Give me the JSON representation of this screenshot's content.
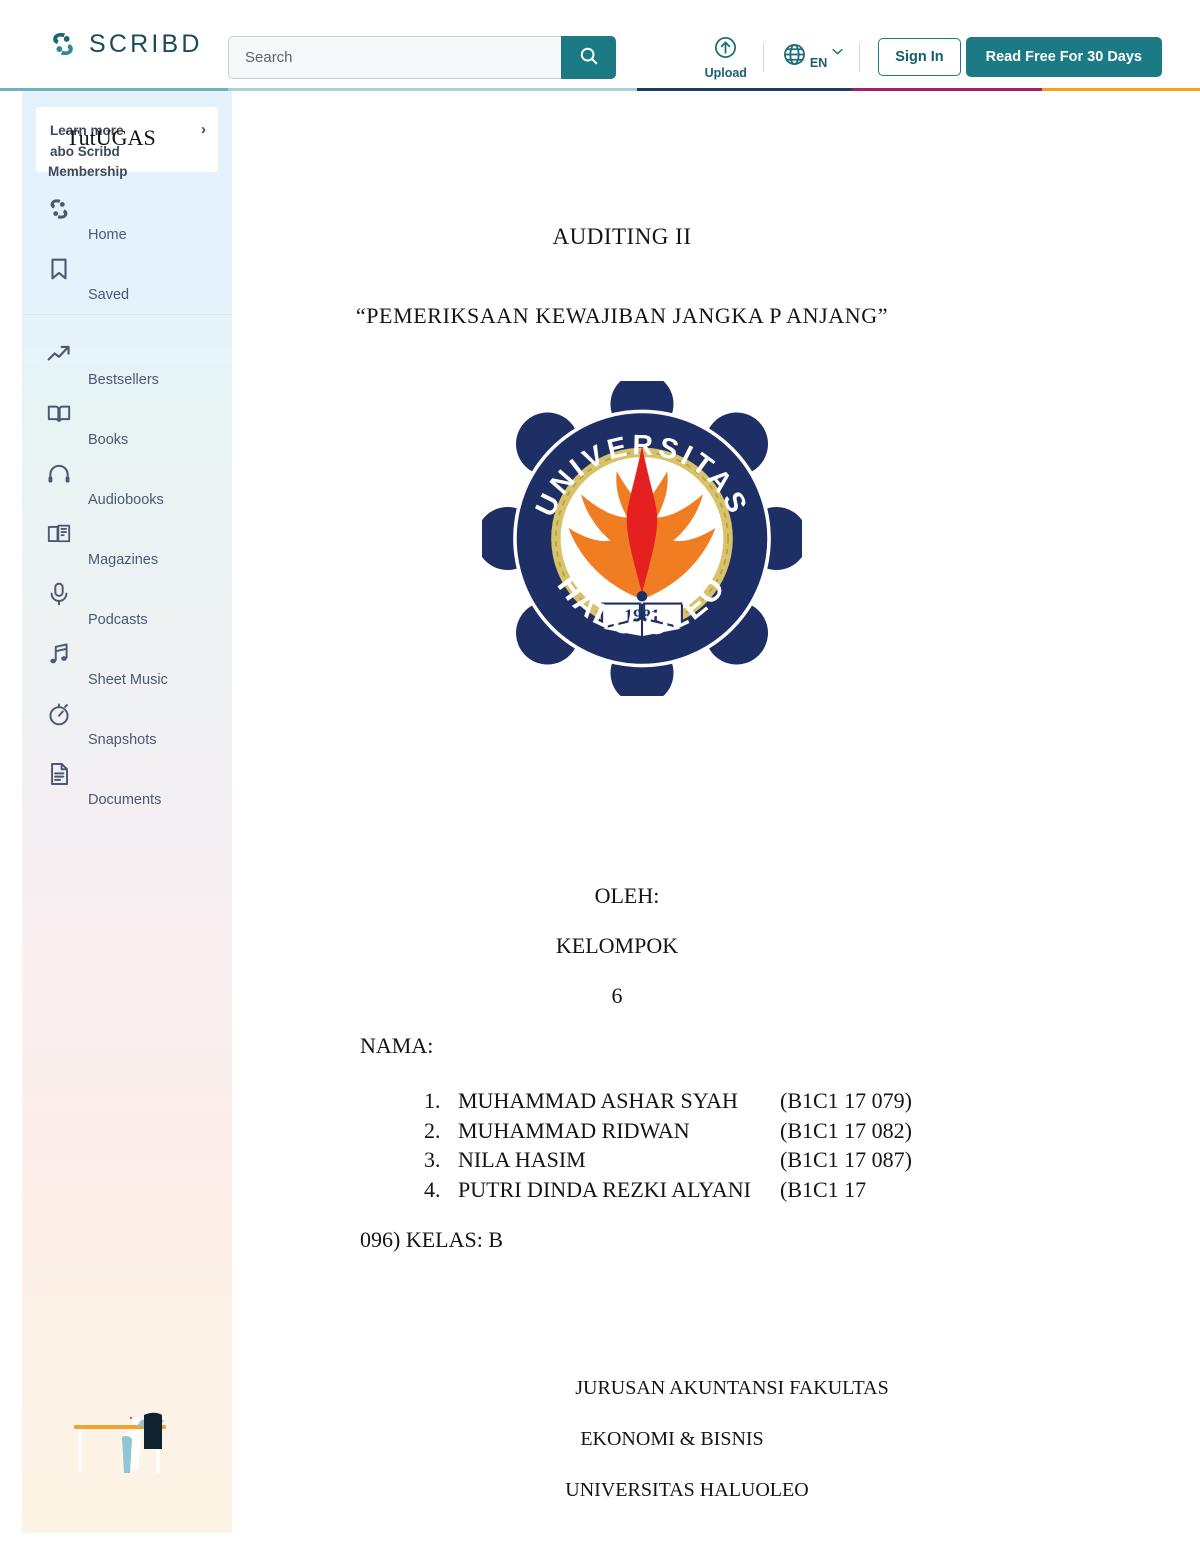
{
  "header": {
    "brand": "SCRIBD",
    "brand_icon": "scribd-logo-icon",
    "search": {
      "placeholder": "Search",
      "value": "",
      "icon": "search-icon"
    },
    "upload": {
      "label": "Upload",
      "icon": "upload-arrow-icon"
    },
    "language": {
      "code": "EN",
      "icon": "globe-icon",
      "chevron": "chevron-down-icon"
    },
    "sign_in_label": "Sign In",
    "cta_label": "Read Free For 30 Days",
    "accent_color": "#1c7a85",
    "strip_colors": [
      "#6fb3bf",
      "#a8d0d8",
      "#1f3d63",
      "#a31f5e",
      "#f5a019"
    ]
  },
  "sidebar": {
    "promo": {
      "line1": "Learn more",
      "line2": "abo",
      "line3": " Scribd",
      "line4": "Membership",
      "artifact": "TutUGAS",
      "chevron": "›"
    },
    "items": [
      {
        "label": "Home",
        "icon": "scribd-home-icon"
      },
      {
        "label": "Saved",
        "icon": "bookmark-icon"
      },
      {
        "label": "Bestsellers",
        "icon": "trending-up-icon"
      },
      {
        "label": "Books",
        "icon": "open-book-icon"
      },
      {
        "label": "Audiobooks",
        "icon": "headphones-icon"
      },
      {
        "label": "Magazines",
        "icon": "magazine-icon"
      },
      {
        "label": "Podcasts",
        "icon": "microphone-icon"
      },
      {
        "label": "Sheet Music",
        "icon": "music-note-icon"
      },
      {
        "label": "Snapshots",
        "icon": "stopwatch-icon"
      },
      {
        "label": "Documents",
        "icon": "document-icon"
      }
    ],
    "illustration": "person-at-desk-illustration"
  },
  "document": {
    "title": "AUDITING II",
    "subtitle": "“PEMERIKSAAN KEWAJIBAN JANGKA P ANJANG”",
    "logo": {
      "name": "universitas-halu-oleo-seal",
      "top_text": "UNIVERSITAS",
      "bottom_text": "HALU OLEO",
      "year": "1981",
      "badge_color": "#1e2f66",
      "rope_color": "#d8c26a",
      "flame_orange": "#f07d22",
      "flame_red": "#e52020"
    },
    "oleh": "OLEH:",
    "kelompok": "KELOMPOK",
    "number": "6",
    "nama_label": "NAMA:",
    "students": [
      {
        "num": "1.",
        "name": "MUHAMMAD ASHAR SYAH",
        "id": "(B1C1 17 079)"
      },
      {
        "num": "2.",
        "name": "MUHAMMAD RIDWAN",
        "id": "(B1C1 17 082)"
      },
      {
        "num": "3.",
        "name": "NILA HASIM",
        "id": "(B1C1 17 087)"
      },
      {
        "num": "4.",
        "name": "PUTRI DINDA REZKI ALYANI",
        "id": "(B1C1 17"
      }
    ],
    "kelas_line": "096) KELAS: B",
    "footer": [
      "JURUSAN AKUNTANSI FAKULTAS",
      "EKONOMI & BISNIS",
      "UNIVERSITAS HALUOLEO"
    ]
  }
}
